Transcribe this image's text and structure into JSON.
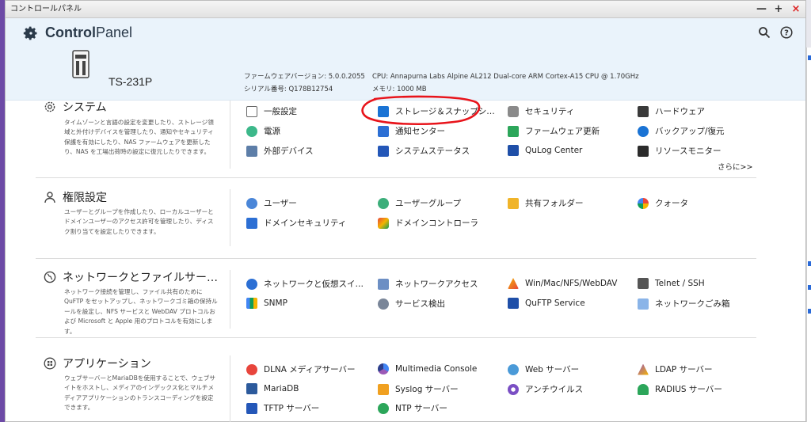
{
  "window": {
    "title": "コントロールパネル",
    "controls": [
      "—",
      "+",
      "×"
    ]
  },
  "header": {
    "app_name_bold": "Control",
    "app_name_rest": "Panel",
    "model": "TS-231P",
    "firmware": "ファームウェアバージョン: 5.0.0.2055",
    "serial": "シリアル番号: Q178B12754",
    "cpu": "CPU: Annapurna Labs Alpine AL212 Dual-core ARM Cortex-A15 CPU @ 1.70GHz",
    "memory": "メモリ: 1000 MB"
  },
  "sections": {
    "system": {
      "title": "システム",
      "desc": "タイムゾーンと言語の設定を変更したり、ストレージ領域と外付けデバイスを管理したり、通知やセキュリティ保護を有効にしたり、NAS ファームウェアを更新したり、NAS を工場出荷時の設定に復元したりできます。",
      "items": [
        "一般設定",
        "ストレージ＆スナップシ…",
        "セキュリティ",
        "ハードウェア",
        "電源",
        "通知センター",
        "ファームウェア更新",
        "バックアップ/復元",
        "外部デバイス",
        "システムステータス",
        "QuLog Center",
        "リソースモニター"
      ],
      "more": "さらに>>"
    },
    "privilege": {
      "title": "権限設定",
      "desc": "ユーザーとグループを作成したり、ローカルユーザーとドメインユーザーのアクセス許可を管理したり、ディスク割り当てを設定したりできます。",
      "items": [
        "ユーザー",
        "ユーザーグループ",
        "共有フォルダー",
        "クォータ",
        "ドメインセキュリティ",
        "ドメインコントローラ"
      ]
    },
    "network": {
      "title": "ネットワークとファイルサー…",
      "desc": "ネットワーク接続を管理し、ファイル共有のためにQuFTP をセットアップし、ネットワークゴミ箱の保持ルールを設定し、NFS サービスと WebDAV プロトコルおよび Microsoft と Apple 用のプロトコルを有効にします。",
      "items": [
        "ネットワークと仮想スイ…",
        "ネットワークアクセス",
        "Win/Mac/NFS/WebDAV",
        "Telnet / SSH",
        "SNMP",
        "サービス検出",
        "QuFTP Service",
        "ネットワークごみ箱"
      ]
    },
    "apps": {
      "title": "アプリケーション",
      "desc": "ウェブサーバーとMariaDBを使用することで、ウェブサイトをホストし、メディアのインデックス化とマルチメディアアプリケーションのトランスコーディングを設定できます。",
      "items": [
        "DLNA メディアサーバー",
        "Multimedia Console",
        "Web サーバー",
        "LDAP サーバー",
        "MariaDB",
        "Syslog サーバー",
        "アンチウイルス",
        "RADIUS サーバー",
        "TFTP サーバー",
        "NTP サーバー"
      ]
    }
  },
  "colors": {
    "accent": "#1a73d4",
    "annotation": "#e8141b",
    "header_bg": "#eaf3fb"
  }
}
